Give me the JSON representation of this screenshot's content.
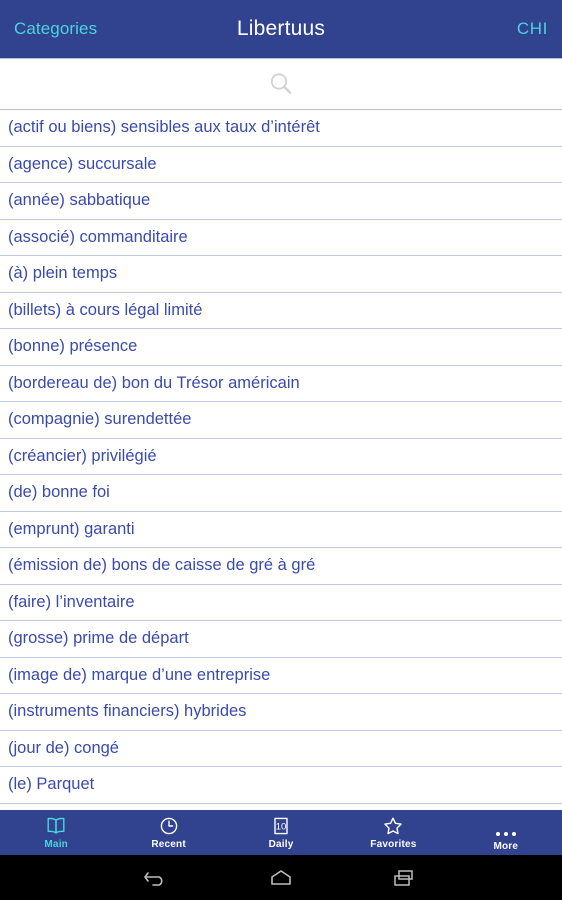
{
  "header": {
    "left_button": "Categories",
    "title": "Libertuus",
    "right_button": "CHI",
    "bg_color": "#31428f",
    "accent_color": "#4ad4dd"
  },
  "search": {
    "icon": "search-icon",
    "placeholder": "",
    "value": ""
  },
  "list": {
    "text_color": "#3a4bab",
    "items": [
      "(actif ou biens) sensibles aux taux d’intérêt",
      "(agence) succursale",
      "(année) sabbatique",
      "(associé) commanditaire",
      "(à) plein temps",
      "(billets) à cours légal limité",
      "(bonne) présence",
      "(bordereau de) bon du Trésor américain",
      "(compagnie) surendettée",
      "(créancier) privilégié",
      "(de) bonne foi",
      "(emprunt) garanti",
      "(émission de) bons de caisse de gré à gré",
      "(faire) l’inventaire",
      "(grosse) prime de départ",
      "(image de) marque d’une entreprise",
      "(instruments financiers) hybrides",
      "(jour de) congé",
      "(le) Parquet"
    ]
  },
  "tabbar": {
    "active_index": 0,
    "active_color": "#4ad4dd",
    "inactive_color": "#ffffff",
    "tabs": [
      {
        "label": "Main",
        "icon": "book-icon"
      },
      {
        "label": "Recent",
        "icon": "clock-icon"
      },
      {
        "label": "Daily",
        "icon": "calendar-icon",
        "icon_text": "10"
      },
      {
        "label": "Favorites",
        "icon": "star-icon"
      },
      {
        "label": "More",
        "icon": "ellipsis-icon"
      }
    ]
  },
  "navbar": {
    "buttons": [
      {
        "name": "back",
        "icon": "back-arrow-icon"
      },
      {
        "name": "home",
        "icon": "home-icon"
      },
      {
        "name": "recents",
        "icon": "recent-apps-icon"
      }
    ]
  }
}
